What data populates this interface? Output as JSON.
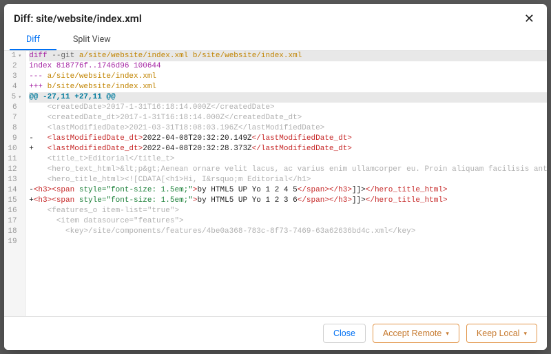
{
  "dialog": {
    "title": "Diff: site/website/index.xml"
  },
  "tabs": [
    {
      "label": "Diff",
      "active": true
    },
    {
      "label": "Split View",
      "active": false
    }
  ],
  "buttons": {
    "close": "Close",
    "accept_remote": "Accept Remote",
    "keep_local": "Keep Local"
  },
  "diff": {
    "file_a": "a/site/website/index.xml",
    "file_b": "b/site/website/index.xml",
    "index_line": "index 818776f..1746d96 100644",
    "hunk_header": "@@ -27,11 +27,11 @@",
    "lines": [
      {
        "n": "1",
        "fold": true,
        "kind": "cmd",
        "content": "diff --git a/site/website/index.xml b/site/website/index.xml"
      },
      {
        "n": "2",
        "fold": false,
        "kind": "idx",
        "content": "index 818776f..1746d96 100644"
      },
      {
        "n": "3",
        "fold": false,
        "kind": "rm",
        "content": "--- a/site/website/index.xml"
      },
      {
        "n": "4",
        "fold": false,
        "kind": "ad",
        "content": "+++ b/site/website/index.xml"
      },
      {
        "n": "5",
        "fold": true,
        "kind": "hunk",
        "content": "@@ -27,11 +27,11 @@"
      },
      {
        "n": "6",
        "fold": false,
        "kind": "ctx",
        "content": "    <createdDate>2017-1-31T16:18:14.000Z</createdDate>"
      },
      {
        "n": "7",
        "fold": false,
        "kind": "ctx",
        "content": "    <createdDate_dt>2017-1-31T16:18:14.000Z</createdDate_dt>"
      },
      {
        "n": "8",
        "fold": false,
        "kind": "ctx",
        "content": "    <lastModifiedDate>2021-03-31T18:08:03.196Z</lastModifiedDate>"
      },
      {
        "n": "9",
        "fold": false,
        "kind": "del",
        "content": "-   <lastModifiedDate_dt>2022-04-08T20:32:20.149Z</lastModifiedDate_dt>"
      },
      {
        "n": "10",
        "fold": false,
        "kind": "ins",
        "content": "+   <lastModifiedDate_dt>2022-04-08T20:32:28.373Z</lastModifiedDate_dt>"
      },
      {
        "n": "11",
        "fold": false,
        "kind": "ctx",
        "content": "    <title_t>Editorial</title_t>"
      },
      {
        "n": "12",
        "fold": false,
        "kind": "ctx",
        "content": "    <hero_text_html>&lt;p&gt;Aenean ornare velit lacus, ac varius enim ullamcorper eu. Proin aliquam facilisis ante int"
      },
      {
        "n": "13",
        "fold": false,
        "kind": "ctx",
        "content": "    <hero_title_html><![CDATA[<h1>Hi, I&rsquo;m Editorial</h1>"
      },
      {
        "n": "14",
        "fold": false,
        "kind": "del2",
        "content": "-<h3><span style=\"font-size: 1.5em;\">by HTML5 UP Yo 1 2 4 5</span></h3>]]></hero_title_html>"
      },
      {
        "n": "15",
        "fold": false,
        "kind": "ins2",
        "content": "+<h3><span style=\"font-size: 1.5em;\">by HTML5 UP Yo 1 2 3 6</span></h3>]]></hero_title_html>"
      },
      {
        "n": "16",
        "fold": false,
        "kind": "ctx",
        "content": "    <features_o item-list=\"true\">"
      },
      {
        "n": "17",
        "fold": false,
        "kind": "ctx",
        "content": "      <item datasource=\"features\">"
      },
      {
        "n": "18",
        "fold": false,
        "kind": "ctx",
        "content": "        <key>/site/components/features/4be0a368-783c-8f73-7469-63a62636bd4c.xml</key>"
      },
      {
        "n": "19",
        "fold": false,
        "kind": "blank",
        "content": ""
      }
    ]
  }
}
